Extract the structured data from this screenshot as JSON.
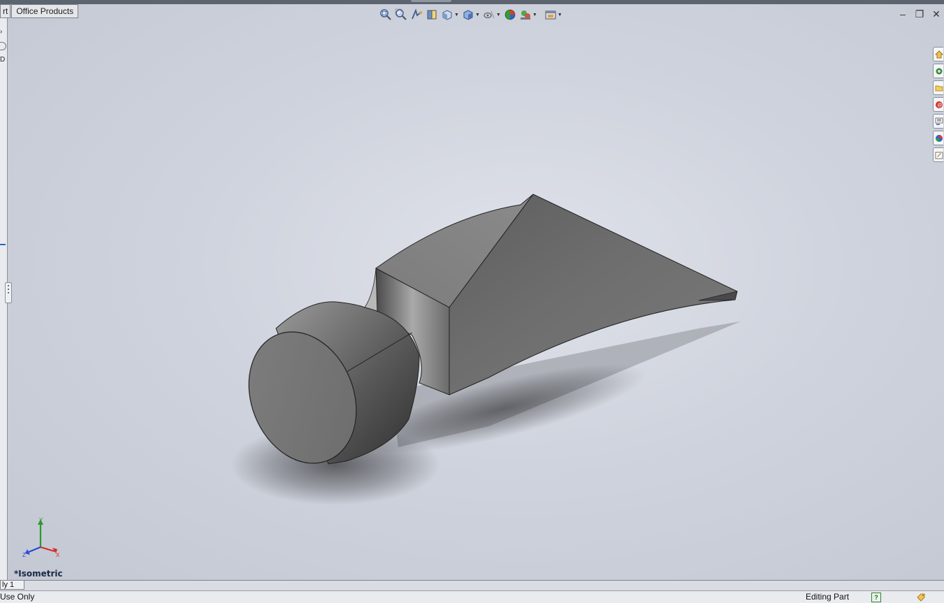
{
  "tabs": [
    {
      "label": "rt"
    },
    {
      "label": "Office Products"
    }
  ],
  "heads_up_toolbar": [
    {
      "icon": "zoom-to-fit-icon"
    },
    {
      "icon": "zoom-to-area-icon"
    },
    {
      "icon": "previous-view-icon"
    },
    {
      "icon": "section-view-icon"
    },
    {
      "icon": "view-orientation-icon",
      "dropdown": true
    },
    {
      "icon": "display-style-icon",
      "dropdown": true
    },
    {
      "icon": "hide-show-items-icon",
      "dropdown": true
    },
    {
      "icon": "edit-appearance-icon"
    },
    {
      "icon": "apply-scene-icon",
      "dropdown": true
    },
    {
      "icon": "view-settings-icon",
      "dropdown": true
    }
  ],
  "window_controls": {
    "minimize": "–",
    "restore": "❐",
    "close": "✕"
  },
  "task_pane": [
    {
      "icon": "home-icon"
    },
    {
      "icon": "design-library-icon"
    },
    {
      "icon": "file-explorer-icon"
    },
    {
      "icon": "search-icon"
    },
    {
      "icon": "view-palette-icon"
    },
    {
      "icon": "appearances-icon"
    },
    {
      "icon": "custom-properties-icon"
    }
  ],
  "left_pane_fragments": [
    "D"
  ],
  "triad": {
    "x": "X",
    "y": "Y",
    "z": "Z"
  },
  "view_label": "*Isometric",
  "model_tab": "ly 1",
  "status": {
    "left": "Use Only",
    "right": "Editing Part",
    "help": "?"
  },
  "colors": {
    "viewport_bg": "#c8ccd6",
    "axis_x": "#d42a2a",
    "axis_y": "#2a9a2a",
    "axis_z": "#2a4ad4",
    "model_gray": "#6f6f6f"
  }
}
